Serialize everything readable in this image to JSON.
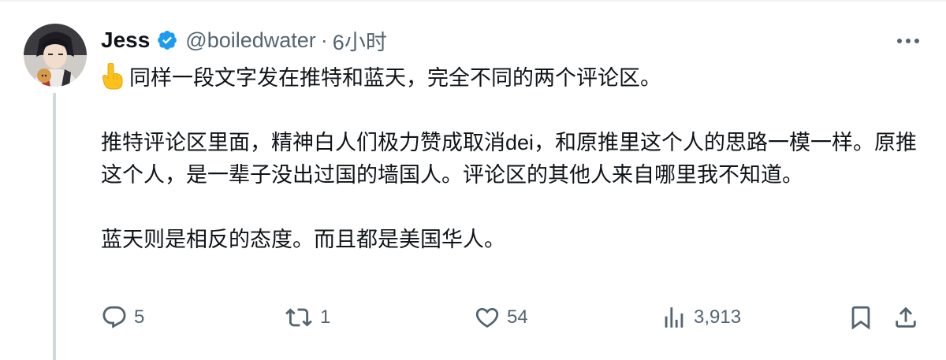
{
  "post": {
    "author_name": "Jess",
    "handle": "@boiledwater",
    "separator": "·",
    "time": "6小时",
    "emoji": "👆",
    "paragraphs": [
      "同样一段文字发在推特和蓝天，完全不同的两个评论区。",
      "推特评论区里面，精神白人们极力赞成取消dei，和原推里这个人的思路一模一样。原推这个人，是一辈子没出过国的墙国人。评论区的其他人来自哪里我不知道。",
      "蓝天则是相反的态度。而且都是美国华人。"
    ]
  },
  "actions": {
    "replies": "5",
    "reposts": "1",
    "likes": "54",
    "views": "3,913"
  },
  "icons": {
    "verified": "verified-badge-icon",
    "more": "more-dots-icon",
    "reply": "reply-bubble-icon",
    "repost": "repost-arrows-icon",
    "like": "heart-icon",
    "views": "bar-chart-icon",
    "bookmark": "bookmark-icon",
    "share": "share-upload-icon"
  },
  "colors": {
    "text": "#0f1419",
    "secondary": "#536471",
    "verified": "#1d9bf0",
    "thread_line": "#cfd9de"
  }
}
